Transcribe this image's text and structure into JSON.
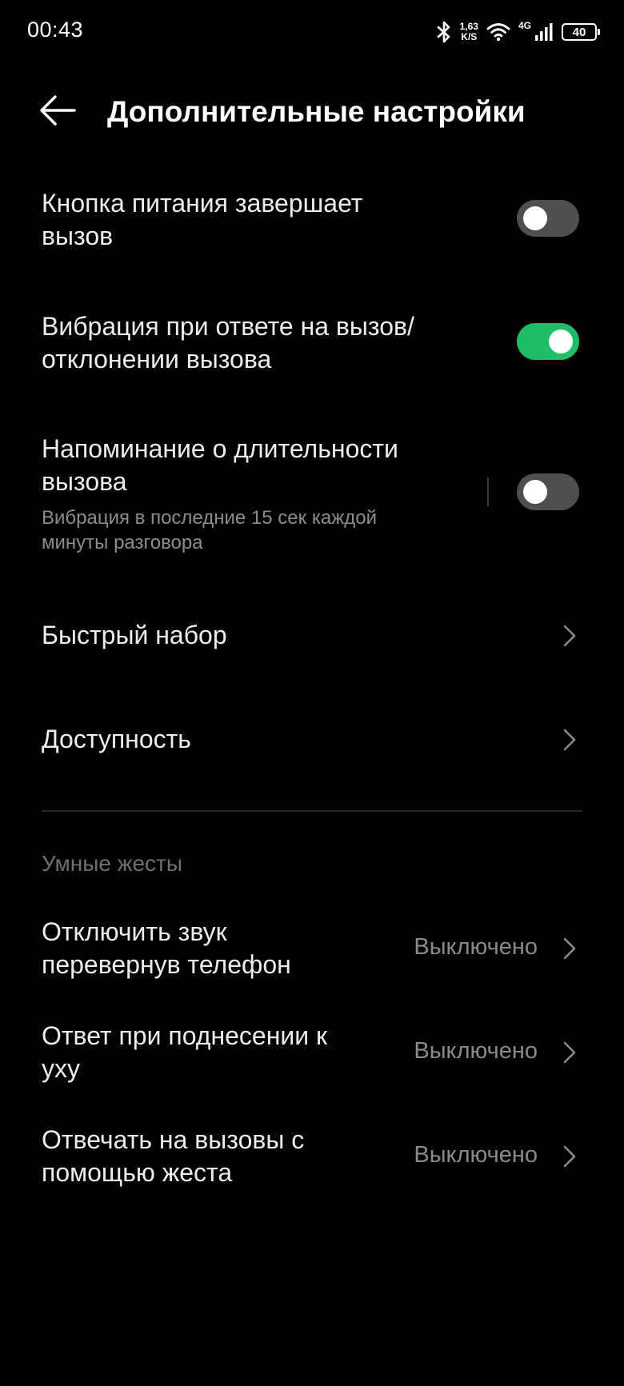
{
  "status_bar": {
    "time": "00:43",
    "speed_value": "1,63",
    "speed_unit": "K/S",
    "network": "4G",
    "battery": "40",
    "icons": [
      "bluetooth-icon",
      "wifi-icon",
      "signal-icon",
      "battery-icon"
    ]
  },
  "header": {
    "title": "Дополнительные настройки",
    "back_icon": "arrow-left-icon"
  },
  "settings": {
    "power_button_ends_call": {
      "title_line1": "Кнопка питания завершает",
      "title_line2": "вызов",
      "enabled": false
    },
    "vibrate_on_answer": {
      "title_line1": "Вибрация при ответе на вызов/",
      "title_line2": "отклонении вызова",
      "enabled": true
    },
    "call_duration_reminder": {
      "title_line1": "Напоминание о длительности",
      "title_line2": "вызова",
      "sub_line1": "Вибрация в последние 15 сек каждой",
      "sub_line2": "минуты разговора",
      "enabled": false
    },
    "speed_dial": {
      "title": "Быстрый набор"
    },
    "accessibility": {
      "title": "Доступность"
    }
  },
  "smart_gestures": {
    "section_label": "Умные жесты",
    "items": [
      {
        "title_line1": "Отключить звук",
        "title_line2": "перевернув телефон",
        "value": "Выключено"
      },
      {
        "title_line1": "Ответ при поднесении к",
        "title_line2": "уху",
        "value": "Выключено"
      },
      {
        "title_line1": "Отвечать на вызовы с",
        "title_line2": "помощью жеста",
        "value": "Выключено"
      }
    ]
  },
  "colors": {
    "background": "#000000",
    "toggle_on": "#1fbd66",
    "toggle_off": "#4f4f4f",
    "secondary_text": "#8a8a8a"
  }
}
